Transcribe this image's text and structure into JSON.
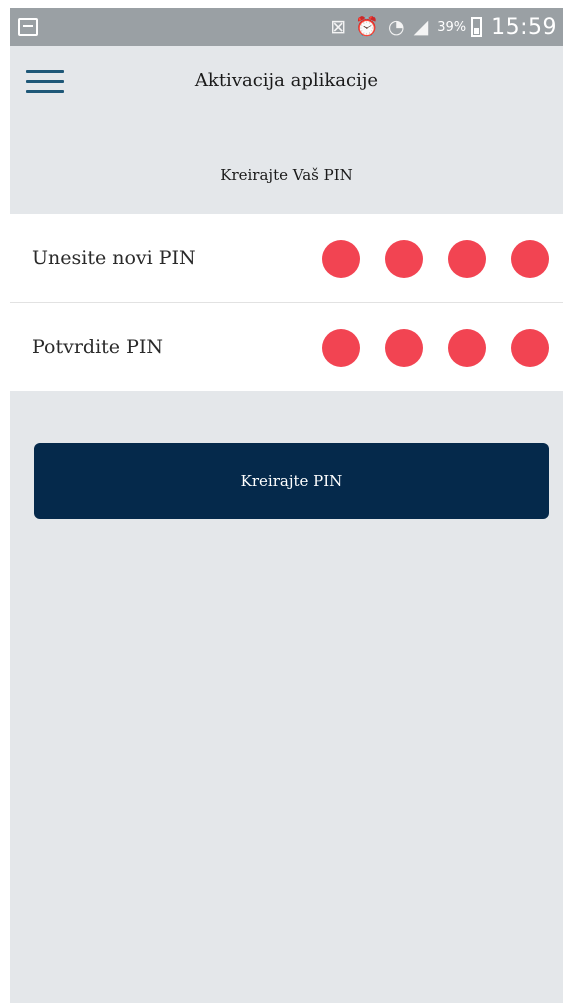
{
  "status_bar": {
    "battery_percent": "39%",
    "time": "15:59",
    "icons": [
      "gallery-icon",
      "nfc-icon",
      "alarm-icon",
      "wifi-icon",
      "signal-icon",
      "battery-icon"
    ]
  },
  "header": {
    "title": "Aktivacija aplikacije"
  },
  "section": {
    "title": "Kreirajte Vaš PIN"
  },
  "pin_fields": [
    {
      "label": "Unesite novi PIN",
      "filled": 4,
      "length": 4
    },
    {
      "label": "Potvrdite PIN",
      "filled": 4,
      "length": 4
    }
  ],
  "button": {
    "label": "Kreirajte PIN"
  },
  "colors": {
    "background": "#e4e7ea",
    "status_bar": "#9aa0a4",
    "pin_dot": "#f24452",
    "button": "#05294b",
    "menu_icon": "#1e5878"
  }
}
